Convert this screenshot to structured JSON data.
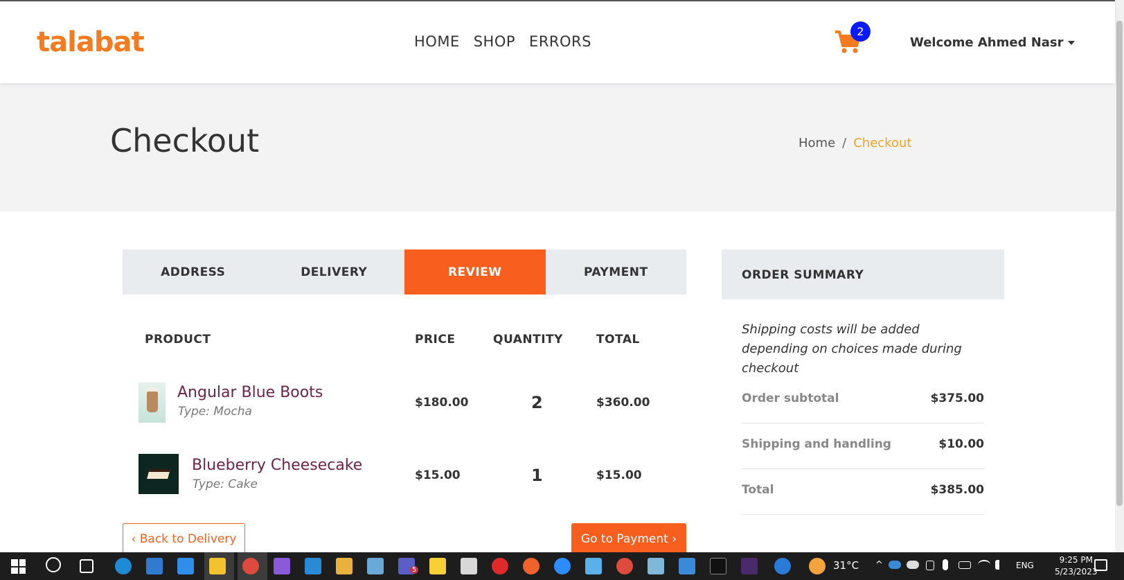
{
  "navbar": {
    "logo": "talabat",
    "links": [
      "HOME",
      "SHOP",
      "ERRORS"
    ],
    "cart_count": "2",
    "welcome": "Welcome Ahmed Nasr"
  },
  "header": {
    "title": "Checkout",
    "breadcrumb_home": "Home",
    "breadcrumb_sep": "/",
    "breadcrumb_active": "Checkout"
  },
  "steps": [
    "ADDRESS",
    "DELIVERY",
    "REVIEW",
    "PAYMENT"
  ],
  "active_step": "REVIEW",
  "table": {
    "headers": {
      "product": "PRODUCT",
      "price": "PRICE",
      "quantity": "QUANTITY",
      "total": "TOTAL"
    },
    "rows": [
      {
        "name": "Angular Blue Boots",
        "type": "Type: Mocha",
        "price": "$180.00",
        "quantity": "2",
        "total": "$360.00"
      },
      {
        "name": "Blueberry Cheesecake",
        "type": "Type: Cake",
        "price": "$15.00",
        "quantity": "1",
        "total": "$15.00"
      }
    ]
  },
  "buttons": {
    "back": "‹ Back to Delivery",
    "next": "Go to Payment ›"
  },
  "summary": {
    "title": "ORDER SUMMARY",
    "note": "Shipping costs will be added depending on choices made during checkout",
    "rows": [
      {
        "label": "Order subtotal",
        "value": "$375.00"
      },
      {
        "label": "Shipping and handling",
        "value": "$10.00"
      },
      {
        "label": "Total",
        "value": "$385.00"
      }
    ]
  },
  "taskbar": {
    "weather": "31°C",
    "lang": "ENG",
    "time": "9:25 PM",
    "date": "5/23/2023",
    "teams_badge": "5"
  },
  "colors": {
    "brand": "#f47b20",
    "accent": "#f85e1e",
    "badge": "#0a1aff",
    "product_name": "#6e2448"
  }
}
